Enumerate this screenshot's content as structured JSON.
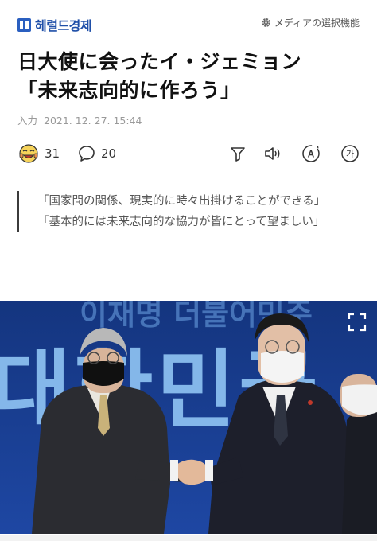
{
  "header": {
    "brand_name": "헤럴드경제",
    "select_label": "メディアの選択機能"
  },
  "article": {
    "title_line1": "日大使に会ったイ・ジェミョン",
    "title_line2": "「未来志向的に作ろう」",
    "date_label": "入力",
    "date_value": "2021. 12. 27. 15:44",
    "reaction_count": "31",
    "comment_count": "20",
    "subheads": [
      "「国家間の関係、現実的に時々出掛けることができる」",
      "「基本的には未来志向的な協力が皆にとって望ましい」"
    ]
  },
  "toolbar": {
    "icons": [
      "funnel-icon",
      "speaker-icon",
      "translate-icon",
      "font-size-icon"
    ],
    "font_size_glyph": "가",
    "translate_glyph": "A"
  },
  "photo": {
    "banner_text_top": "이재명 더불어민주",
    "banner_text_main": "대한민국"
  },
  "colors": {
    "brand": "#1f4fa8",
    "banner_blue": "#1b3a8c",
    "banner_light": "#7fb6ee"
  }
}
